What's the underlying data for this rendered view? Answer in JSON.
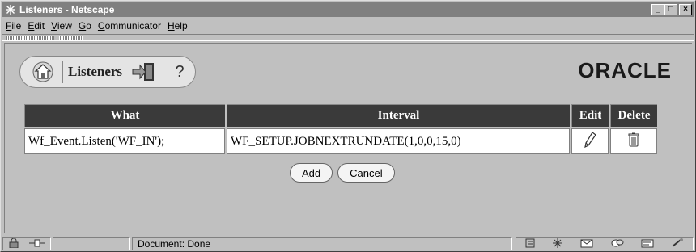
{
  "window": {
    "title": "Listeners - Netscape",
    "controls": [
      "_",
      "□",
      "×"
    ]
  },
  "menu": [
    {
      "label": "File",
      "key": "F",
      "rest": "ile"
    },
    {
      "label": "Edit",
      "key": "E",
      "rest": "dit"
    },
    {
      "label": "View",
      "key": "V",
      "rest": "iew"
    },
    {
      "label": "Go",
      "key": "G",
      "rest": "o"
    },
    {
      "label": "Communicator",
      "key": "C",
      "rest": "ommunicator"
    },
    {
      "label": "Help",
      "key": "H",
      "rest": "elp"
    }
  ],
  "toolbar": {
    "page_label": "Listeners",
    "help_label": "?",
    "brand": "ORACLE"
  },
  "table": {
    "headers": [
      "What",
      "Interval",
      "Edit",
      "Delete"
    ],
    "rows": [
      {
        "what": "Wf_Event.Listen('WF_IN');",
        "interval": "WF_SETUP.JOBNEXTRUNDATE(1,0,0,15,0)"
      }
    ]
  },
  "actions": {
    "add_label": "Add",
    "cancel_label": "Cancel"
  },
  "status": {
    "text": "Document: Done"
  },
  "colors": {
    "header_bg": "#3a3a3a",
    "titlebar_bg": "#808080",
    "chrome": "#c0c0c0"
  }
}
